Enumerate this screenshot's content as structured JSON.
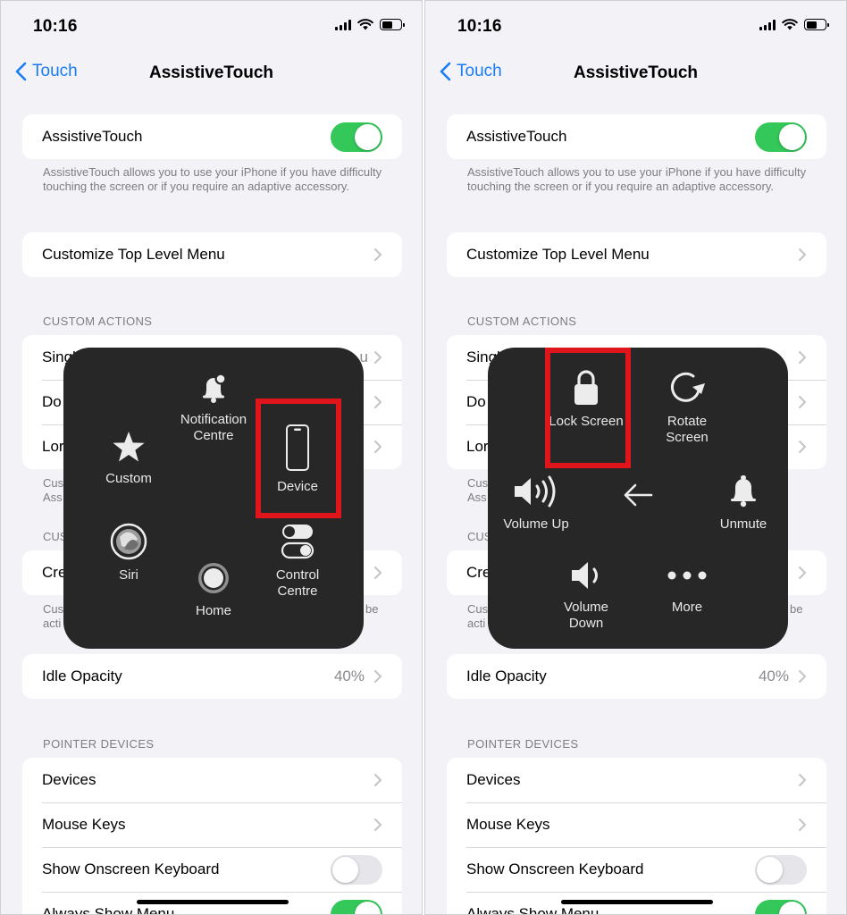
{
  "status": {
    "time": "10:16"
  },
  "nav": {
    "back_label": "Touch",
    "title": "AssistiveTouch"
  },
  "assistive_touch": {
    "label": "AssistiveTouch",
    "enabled": true,
    "description": "AssistiveTouch allows you to use your iPhone if you have difficulty touching the screen or if you require an adaptive accessory."
  },
  "customize_top_level_menu": "Customize Top Level Menu",
  "custom_actions": {
    "header": "CUSTOM ACTIONS",
    "rows": [
      "Singl",
      "Do",
      "Lor"
    ],
    "value_fragment": "u"
  },
  "custom_gestures": {
    "header_fragment": "CUS",
    "note_fragment_1": "Cus",
    "note_fragment_2": "Ass",
    "note_fragment_3": "Cus",
    "note_fragment_4": "acti",
    "note_fragment_5": "be",
    "create_fragment": "Cre"
  },
  "idle_opacity": {
    "label": "Idle Opacity",
    "value": "40%"
  },
  "pointer_devices": {
    "header": "POINTER DEVICES",
    "items": [
      "Devices",
      "Mouse Keys",
      "Show Onscreen Keyboard",
      "Always Show Menu"
    ],
    "show_keyboard_enabled": false,
    "always_show_menu_enabled": true
  },
  "menu_left": {
    "notification_centre": "Notification Centre",
    "custom": "Custom",
    "device": "Device",
    "siri": "Siri",
    "control_centre": "Control Centre",
    "home": "Home"
  },
  "menu_right": {
    "lock_screen": "Lock Screen",
    "rotate_screen": "Rotate Screen",
    "volume_up": "Volume Up",
    "unmute": "Unmute",
    "volume_down": "Volume Down",
    "more": "More"
  },
  "colors": {
    "accent": "#1a7cf5",
    "toggle_on": "#34c759",
    "highlight": "#e0151b",
    "menu_bg": "#272727"
  }
}
